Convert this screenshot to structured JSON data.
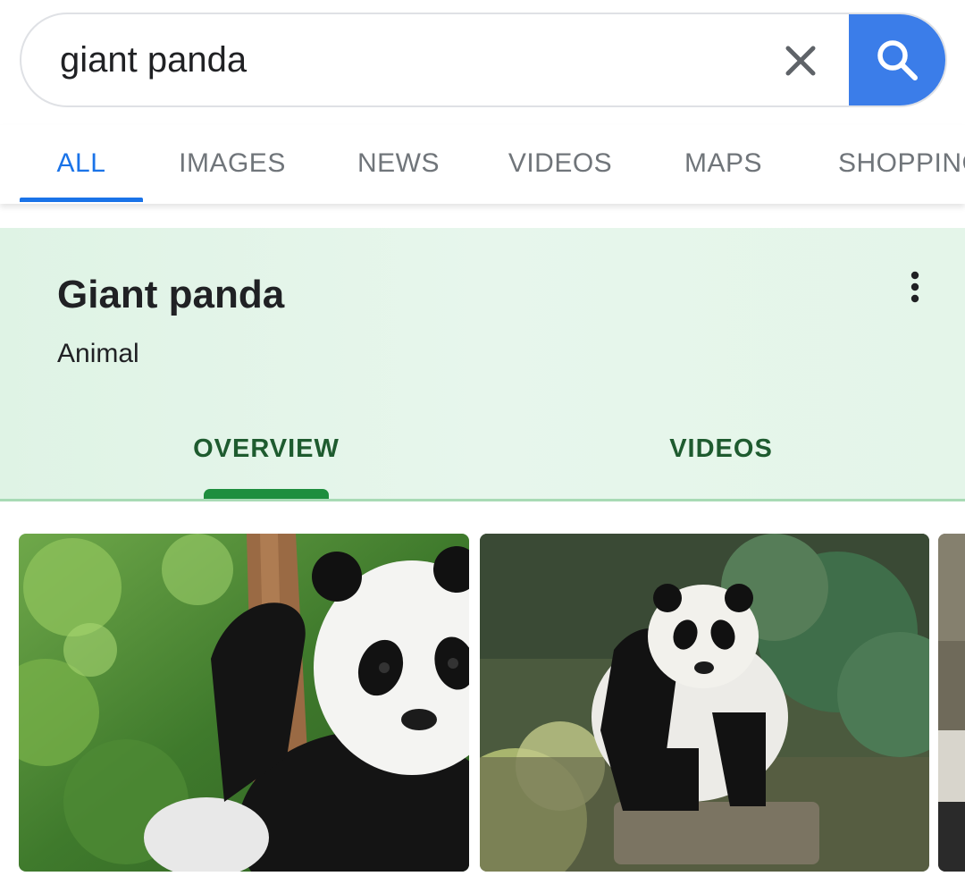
{
  "search": {
    "query": "giant panda",
    "clear_icon": "close-icon",
    "submit_icon": "search-icon",
    "accent": "#3b7de9"
  },
  "tabs": [
    {
      "label": "ALL",
      "active": true
    },
    {
      "label": "IMAGES",
      "active": false
    },
    {
      "label": "NEWS",
      "active": false
    },
    {
      "label": "VIDEOS",
      "active": false
    },
    {
      "label": "MAPS",
      "active": false
    },
    {
      "label": "SHOPPING",
      "active": false
    }
  ],
  "knowledge_panel": {
    "title": "Giant panda",
    "subtitle": "Animal",
    "menu_icon": "more-vert-icon",
    "tabs": [
      {
        "label": "OVERVIEW",
        "active": true
      },
      {
        "label": "VIDEOS",
        "active": false
      }
    ],
    "accent": "#1e8e3e"
  },
  "images": [
    {
      "subject": "panda cub climbing tree"
    },
    {
      "subject": "adult panda standing among plants"
    },
    {
      "subject": "partially visible panda image"
    }
  ]
}
